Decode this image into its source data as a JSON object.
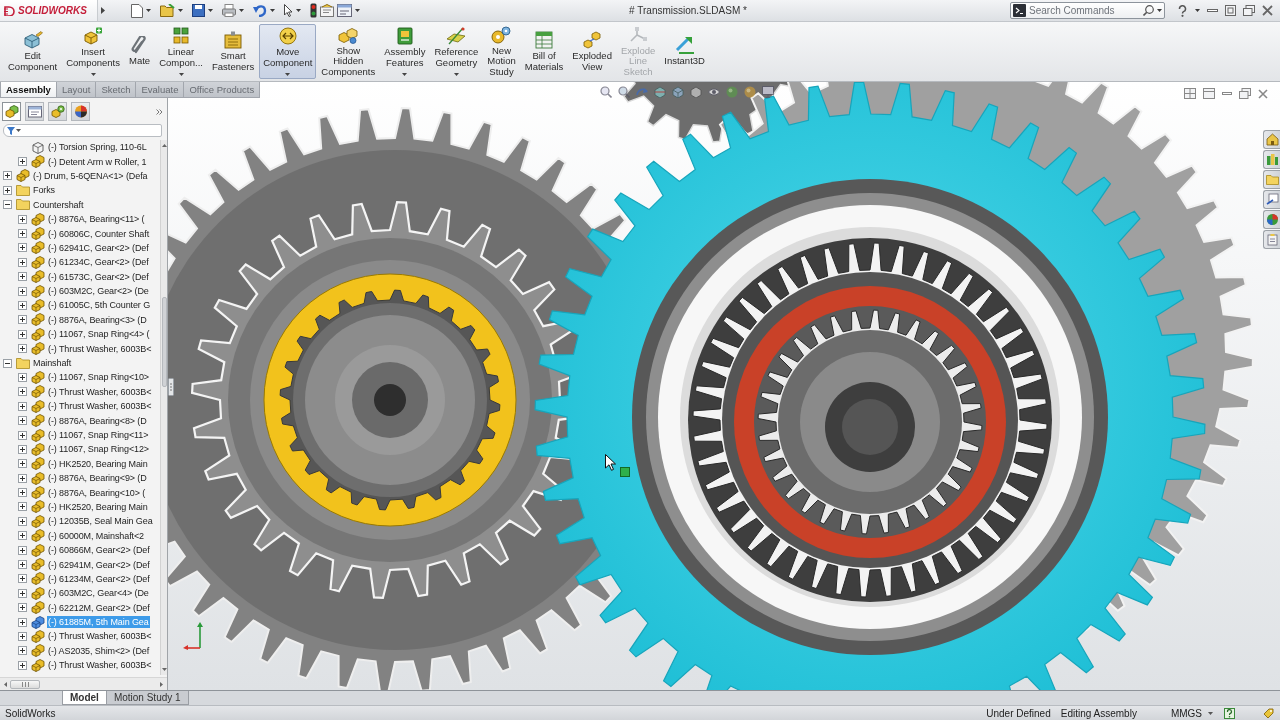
{
  "title_bar": {
    "logo": "SOLIDWORKS",
    "document_title": "# Transmission.SLDASM *",
    "search": {
      "placeholder": "Search Commands"
    }
  },
  "ribbon": {
    "buttons": [
      {
        "lines": [
          "Edit",
          "Component"
        ],
        "dropdown": false,
        "selected": false,
        "disabled": false
      },
      {
        "lines": [
          "Insert",
          "Components"
        ],
        "dropdown": true,
        "selected": false,
        "disabled": false
      },
      {
        "lines": [
          "Mate"
        ],
        "dropdown": false,
        "selected": false,
        "disabled": false
      },
      {
        "lines": [
          "Linear",
          "Compon..."
        ],
        "dropdown": true,
        "selected": false,
        "disabled": false
      },
      {
        "lines": [
          "Smart",
          "Fasteners"
        ],
        "dropdown": false,
        "selected": false,
        "disabled": false
      },
      {
        "lines": [
          "Move",
          "Component"
        ],
        "dropdown": true,
        "selected": true,
        "disabled": false
      },
      {
        "lines": [
          "Show",
          "Hidden",
          "Components"
        ],
        "dropdown": false,
        "selected": false,
        "disabled": false
      },
      {
        "lines": [
          "Assembly",
          "Features"
        ],
        "dropdown": true,
        "selected": false,
        "disabled": false
      },
      {
        "lines": [
          "Reference",
          "Geometry"
        ],
        "dropdown": true,
        "selected": false,
        "disabled": false
      },
      {
        "lines": [
          "New",
          "Motion",
          "Study"
        ],
        "dropdown": false,
        "selected": false,
        "disabled": false
      },
      {
        "lines": [
          "Bill of",
          "Materials"
        ],
        "dropdown": false,
        "selected": false,
        "disabled": false
      },
      {
        "lines": [
          "Exploded",
          "View"
        ],
        "dropdown": false,
        "selected": false,
        "disabled": false
      },
      {
        "lines": [
          "Explode",
          "Line",
          "Sketch"
        ],
        "dropdown": false,
        "selected": false,
        "disabled": true
      },
      {
        "lines": [
          "Instant3D"
        ],
        "dropdown": false,
        "selected": false,
        "disabled": false
      }
    ]
  },
  "ribbon_tabs": [
    {
      "label": "Assembly",
      "selected": true
    },
    {
      "label": "Layout",
      "selected": false
    },
    {
      "label": "Sketch",
      "selected": false
    },
    {
      "label": "Evaluate",
      "selected": false
    },
    {
      "label": "Office Products",
      "selected": false
    }
  ],
  "panel_tabs": [
    {
      "selected": true
    },
    {
      "selected": false
    },
    {
      "selected": false
    },
    {
      "selected": false
    }
  ],
  "feature_tree": {
    "partial_children": [
      {
        "label": "(-) Torsion Spring, 110-6L",
        "kind": "part",
        "expandable": false,
        "selected": false
      },
      {
        "label": "(-) Detent Arm w Roller, 1",
        "kind": "assembly",
        "expandable": true,
        "expanded": false,
        "selected": false
      }
    ],
    "items": [
      {
        "label": "(-) Drum, 5-6QENA<1> (Defa",
        "kind": "assembly",
        "expandable": true,
        "expanded": false,
        "selected": false
      },
      {
        "label": "Forks",
        "kind": "folder",
        "expandable": true,
        "expanded": false,
        "selected": false
      },
      {
        "label": "Countershaft",
        "kind": "folder",
        "expandable": true,
        "expanded": true,
        "selected": false,
        "children": [
          {
            "label": "(-) 8876A, Bearing<11> (",
            "kind": "assembly",
            "expandable": true,
            "expanded": false,
            "selected": false
          },
          {
            "label": "(-) 60806C, Counter Shaft",
            "kind": "assembly",
            "expandable": true,
            "expanded": false,
            "selected": false
          },
          {
            "label": "(-) 62941C, Gear<2> (Def",
            "kind": "assembly",
            "expandable": true,
            "expanded": false,
            "selected": false
          },
          {
            "label": "(-) 61234C, Gear<2> (Def",
            "kind": "assembly",
            "expandable": true,
            "expanded": false,
            "selected": false
          },
          {
            "label": "(-) 61573C, Gear<2> (Def",
            "kind": "assembly",
            "expandable": true,
            "expanded": false,
            "selected": false
          },
          {
            "label": "(-) 603M2C, Gear<2> (De",
            "kind": "assembly",
            "expandable": true,
            "expanded": false,
            "selected": false
          },
          {
            "label": "(-) 61005C, 5th Counter G",
            "kind": "assembly",
            "expandable": true,
            "expanded": false,
            "selected": false
          },
          {
            "label": "(-) 8876A, Bearing<3> (D",
            "kind": "assembly",
            "expandable": true,
            "expanded": false,
            "selected": false
          },
          {
            "label": "(-) 11067, Snap Ring<4> (",
            "kind": "assembly",
            "expandable": true,
            "expanded": false,
            "selected": false
          },
          {
            "label": "(-) Thrust Washer, 6003B<",
            "kind": "assembly",
            "expandable": true,
            "expanded": false,
            "selected": false
          }
        ]
      },
      {
        "label": "Mainshaft",
        "kind": "folder",
        "expandable": true,
        "expanded": true,
        "selected": false,
        "children": [
          {
            "label": "(-) 11067, Snap Ring<10>",
            "kind": "assembly",
            "expandable": true,
            "expanded": false,
            "selected": false
          },
          {
            "label": "(-) Thrust Washer, 6003B<",
            "kind": "assembly",
            "expandable": true,
            "expanded": false,
            "selected": false
          },
          {
            "label": "(-) Thrust Washer, 6003B<",
            "kind": "assembly",
            "expandable": true,
            "expanded": false,
            "selected": false
          },
          {
            "label": "(-) 8876A, Bearing<8> (D",
            "kind": "assembly",
            "expandable": true,
            "expanded": false,
            "selected": false
          },
          {
            "label": "(-) 11067, Snap Ring<11>",
            "kind": "assembly",
            "expandable": true,
            "expanded": false,
            "selected": false
          },
          {
            "label": "(-) 11067, Snap Ring<12>",
            "kind": "assembly",
            "expandable": true,
            "expanded": false,
            "selected": false
          },
          {
            "label": "(-) HK2520, Bearing Main",
            "kind": "assembly",
            "expandable": true,
            "expanded": false,
            "selected": false
          },
          {
            "label": "(-) 8876A, Bearing<9> (D",
            "kind": "assembly",
            "expandable": true,
            "expanded": false,
            "selected": false
          },
          {
            "label": "(-) 8876A, Bearing<10> (",
            "kind": "assembly",
            "expandable": true,
            "expanded": false,
            "selected": false
          },
          {
            "label": "(-) HK2520, Bearing Main",
            "kind": "assembly",
            "expandable": true,
            "expanded": false,
            "selected": false
          },
          {
            "label": "(-) 12035B, Seal Main Gea",
            "kind": "assembly",
            "expandable": true,
            "expanded": false,
            "selected": false
          },
          {
            "label": "(-) 60000M, Mainshaft<2",
            "kind": "assembly",
            "expandable": true,
            "expanded": false,
            "selected": false
          },
          {
            "label": "(-) 60866M, Gear<2> (Def",
            "kind": "assembly",
            "expandable": true,
            "expanded": false,
            "selected": false
          },
          {
            "label": "(-) 62941M, Gear<2> (Def",
            "kind": "assembly",
            "expandable": true,
            "expanded": false,
            "selected": false
          },
          {
            "label": "(-) 61234M, Gear<2> (Def",
            "kind": "assembly",
            "expandable": true,
            "expanded": false,
            "selected": false
          },
          {
            "label": "(-) 603M2C, Gear<4> (De",
            "kind": "assembly",
            "expandable": true,
            "expanded": false,
            "selected": false
          },
          {
            "label": "(-) 62212M, Gear<2> (Def",
            "kind": "assembly",
            "expandable": true,
            "expanded": false,
            "selected": false
          },
          {
            "label": "(-) 61885M, 5th Main Gea",
            "kind": "assembly",
            "expandable": true,
            "expanded": false,
            "selected": true
          },
          {
            "label": "(-) Thrust Washer, 6003B<",
            "kind": "assembly",
            "expandable": true,
            "expanded": false,
            "selected": false
          },
          {
            "label": "(-) AS2035, Shim<2> (Def",
            "kind": "assembly",
            "expandable": true,
            "expanded": false,
            "selected": false
          },
          {
            "label": "(-) Thrust Washer, 6003B<",
            "kind": "assembly",
            "expandable": true,
            "expanded": false,
            "selected": false
          }
        ]
      }
    ]
  },
  "bottom_tabs": [
    {
      "label": "Model",
      "selected": true
    },
    {
      "label": "Motion Study 1",
      "selected": false
    }
  ],
  "status_bar": {
    "app": "SolidWorks",
    "state": "Under Defined",
    "mode": "Editing Assembly",
    "units": "MMGS"
  }
}
